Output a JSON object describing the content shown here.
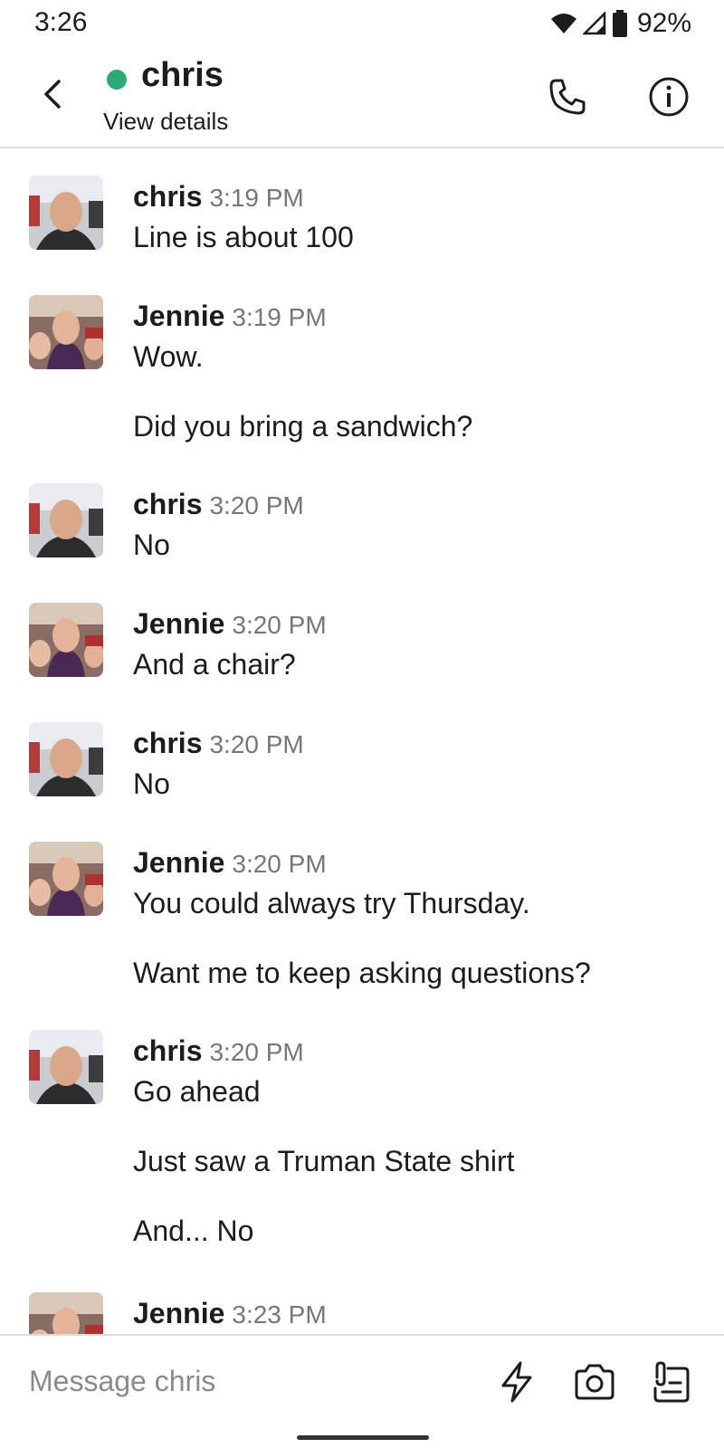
{
  "status_bar": {
    "time": "3:26",
    "battery": "92%"
  },
  "header": {
    "title": "chris",
    "subtitle": "View details"
  },
  "messages": [
    {
      "sender": "chris",
      "time": "3:19 PM",
      "lines": [
        "Line is about 100"
      ]
    },
    {
      "sender": "Jennie",
      "time": "3:19 PM",
      "lines": [
        "Wow.",
        "Did you bring a sandwich?"
      ]
    },
    {
      "sender": "chris",
      "time": "3:20 PM",
      "lines": [
        "No"
      ]
    },
    {
      "sender": "Jennie",
      "time": "3:20 PM",
      "lines": [
        "And a chair?"
      ]
    },
    {
      "sender": "chris",
      "time": "3:20 PM",
      "lines": [
        "No"
      ]
    },
    {
      "sender": "Jennie",
      "time": "3:20 PM",
      "lines": [
        "You could always try Thursday.",
        "Want me to keep asking questions?"
      ]
    },
    {
      "sender": "chris",
      "time": "3:20 PM",
      "lines": [
        "Go ahead",
        "Just saw a Truman State shirt",
        "And... No"
      ]
    },
    {
      "sender": "Jennie",
      "time": "3:23 PM",
      "lines": []
    }
  ],
  "composer": {
    "placeholder": "Message chris"
  },
  "colors": {
    "presence": "#2bac76",
    "text": "#1d1c1d",
    "timestamp": "#777777",
    "divider": "#dddddd"
  },
  "icons": [
    "wifi-icon",
    "signal-icon",
    "battery-icon",
    "back-chevron-icon",
    "phone-icon",
    "info-icon",
    "lightning-icon",
    "camera-icon",
    "attachment-icon"
  ]
}
